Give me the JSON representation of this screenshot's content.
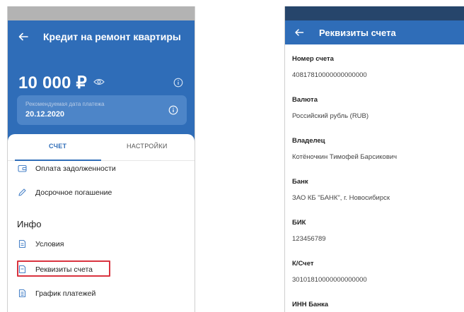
{
  "left": {
    "title": "Кредит на ремонт квартиры",
    "amount": "10 000 ₽",
    "date_hint": "Рекомендуемая дата платежа",
    "date_value": "20.12.2020",
    "tabs": [
      {
        "label": "СЧЕТ"
      },
      {
        "label": "НАСТРОЙКИ"
      }
    ],
    "actions": [
      {
        "label": "Оплата задолженности",
        "icon": "wallet-icon"
      },
      {
        "label": "Досрочное погашение",
        "icon": "pencil-icon"
      }
    ],
    "info_section": "Инфо",
    "info_items": [
      {
        "label": "Условия",
        "icon": "document-icon"
      },
      {
        "label": "Реквизиты счета",
        "icon": "document-icon"
      },
      {
        "label": "График платежей",
        "icon": "document-icon"
      }
    ]
  },
  "right": {
    "title": "Реквизиты счета",
    "fields": [
      {
        "label": "Номер счета",
        "value": "40817810000000000000"
      },
      {
        "label": "Валюта",
        "value": "Российский рубль (RUB)"
      },
      {
        "label": "Владелец",
        "value": "Котёночкин Тимофей Барсикович"
      },
      {
        "label": "Банк",
        "value": "ЗАО КБ \"БАНК\", г. Новосибирск"
      },
      {
        "label": "БИК",
        "value": "123456789"
      },
      {
        "label": "К/Счет",
        "value": "30101810000000000000"
      },
      {
        "label": "ИНН Банка",
        "value": ""
      }
    ]
  },
  "colors": {
    "primary": "#2f6db8",
    "status_bar_right": "#26456b",
    "highlight": "#d9333f",
    "icon_blue": "#4a83c8"
  }
}
